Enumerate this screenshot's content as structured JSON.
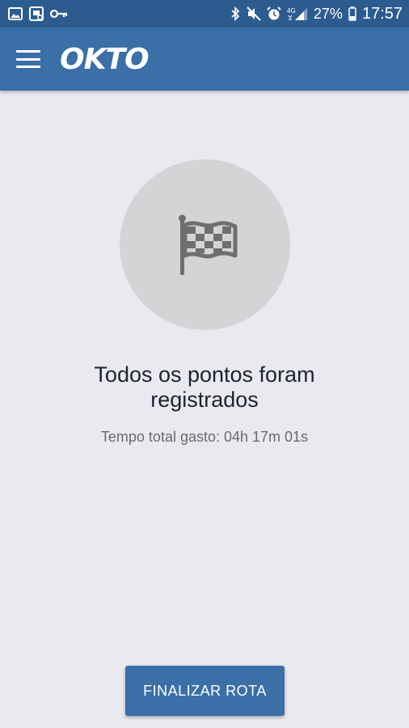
{
  "status_bar": {
    "icons_left": [
      "gallery-icon",
      "screen-icon",
      "key-icon"
    ],
    "icons_right": [
      "bluetooth-icon",
      "mute-icon",
      "alarm-icon",
      "signal-4g-icon"
    ],
    "battery": "27%",
    "time": "17:57"
  },
  "app_bar": {
    "logo": "OKTO"
  },
  "content": {
    "headline": "Todos os pontos foram registrados",
    "subtitle": "Tempo total gasto: 04h 17m 01s"
  },
  "actions": {
    "finish_label": "FINALIZAR ROTA"
  },
  "colors": {
    "status_bar": "#2c5c8f",
    "app_bar": "#3a6fa7",
    "background": "#e9e9ef",
    "circle": "#d4d4d7",
    "icon": "#6f6f72",
    "button": "#3a6fa7"
  }
}
